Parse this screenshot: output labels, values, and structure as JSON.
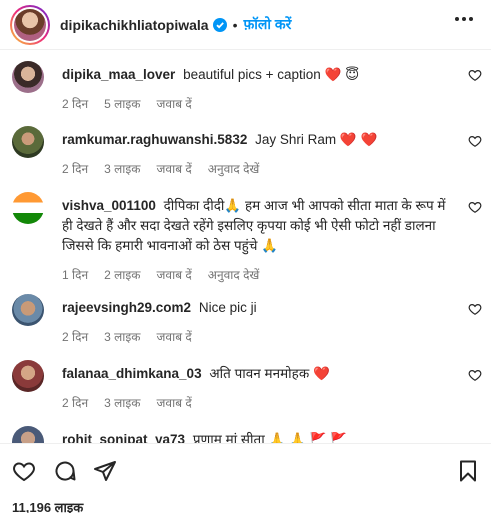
{
  "header": {
    "username": "dipikachikhliatopiwala",
    "separator": "•",
    "follow_label": "फ़ॉलो करें"
  },
  "comments": [
    {
      "user": "dipika_maa_lover",
      "text": "beautiful pics + caption",
      "emoji": "❤️ 😇",
      "time": "2 दिन",
      "likes": "5 लाइक",
      "reply": "जवाब दें",
      "translate": ""
    },
    {
      "user": "ramkumar.raghuwanshi.5832",
      "text": "Jay Shri Ram",
      "emoji": "❤️ ❤️",
      "time": "2 दिन",
      "likes": "3 लाइक",
      "reply": "जवाब दें",
      "translate": "अनुवाद देखें"
    },
    {
      "user": "vishva_001100",
      "text": "दीपिका दीदी🙏 हम आज भी आपको सीता माता के रूप में ही देखते हैं और सदा देखते रहेंगे इसलिए कृपया कोई भी ऐसी फोटो नहीं डालना जिससे कि हमारी भावनाओं को ठेस पहुंचे 🙏",
      "emoji": "",
      "time": "1 दिन",
      "likes": "2 लाइक",
      "reply": "जवाब दें",
      "translate": "अनुवाद देखें"
    },
    {
      "user": "rajeevsingh29.com2",
      "text": "Nice pic ji",
      "emoji": "",
      "time": "2 दिन",
      "likes": "3 लाइक",
      "reply": "जवाब दें",
      "translate": ""
    },
    {
      "user": "falanaa_dhimkana_03",
      "text": "अति पावन मनमोहक",
      "emoji": "❤️",
      "time": "2 दिन",
      "likes": "3 लाइक",
      "reply": "जवाब दें",
      "translate": ""
    },
    {
      "user": "rohit_sonipat_ya73",
      "text": "प्रणाम मां सीता",
      "emoji": "🙏 🙏 🚩 🚩",
      "time": "",
      "likes": "",
      "reply": "",
      "translate": ""
    }
  ],
  "footer": {
    "likes_count": "11,196 लाइक"
  },
  "icons": {
    "verified": "verified-badge-icon",
    "more": "more-options-icon",
    "comment_like": "heart-outline-icon",
    "like": "heart-outline-icon",
    "comment": "comment-bubble-icon",
    "share": "paper-plane-icon",
    "save": "bookmark-icon"
  },
  "colors": {
    "follow_blue": "#0095f6",
    "verified_blue": "#0095f6",
    "meta_gray": "#737373",
    "text": "#262626"
  }
}
